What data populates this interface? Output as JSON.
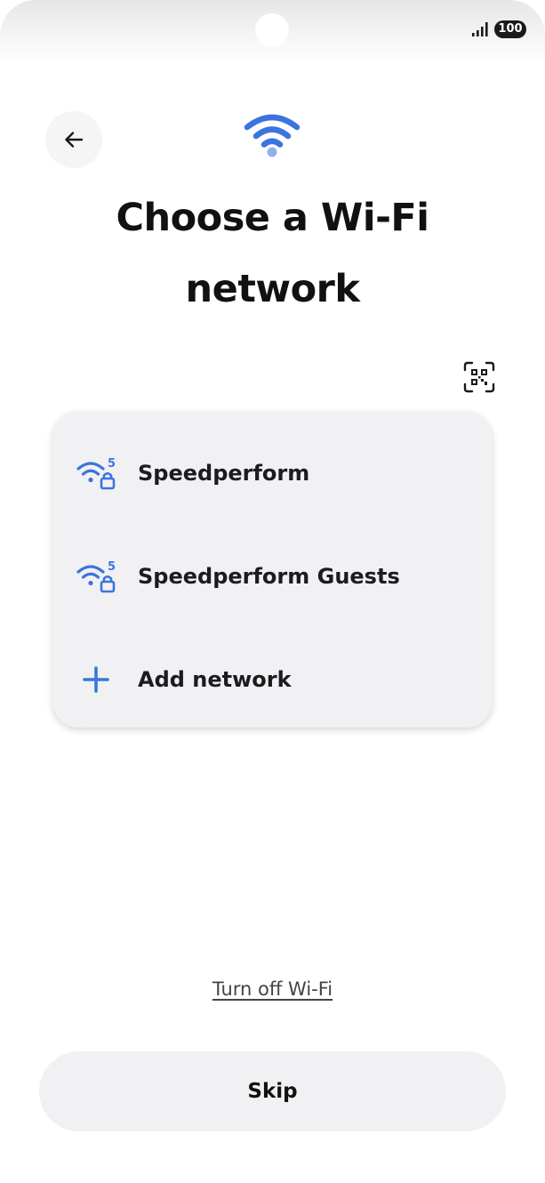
{
  "status_bar": {
    "battery": "100",
    "signal_icon": "cellular-signal-icon"
  },
  "header": {
    "back_icon": "arrow-left-icon",
    "wifi_icon": "wifi-icon",
    "title": "Choose a Wi-Fi network",
    "qr_icon": "qr-code-scan-icon"
  },
  "networks": [
    {
      "name": "Speedperform",
      "icon": "wifi-5ghz-locked-icon"
    },
    {
      "name": "Speedperform Guests",
      "icon": "wifi-5ghz-locked-icon"
    }
  ],
  "add_network": {
    "label": "Add network",
    "icon": "plus-icon"
  },
  "footer": {
    "turn_off_label": "Turn off Wi-Fi",
    "skip_label": "Skip"
  },
  "colors": {
    "accent": "#3b74e0",
    "card_bg": "#f1f1f3",
    "text": "#111111"
  }
}
